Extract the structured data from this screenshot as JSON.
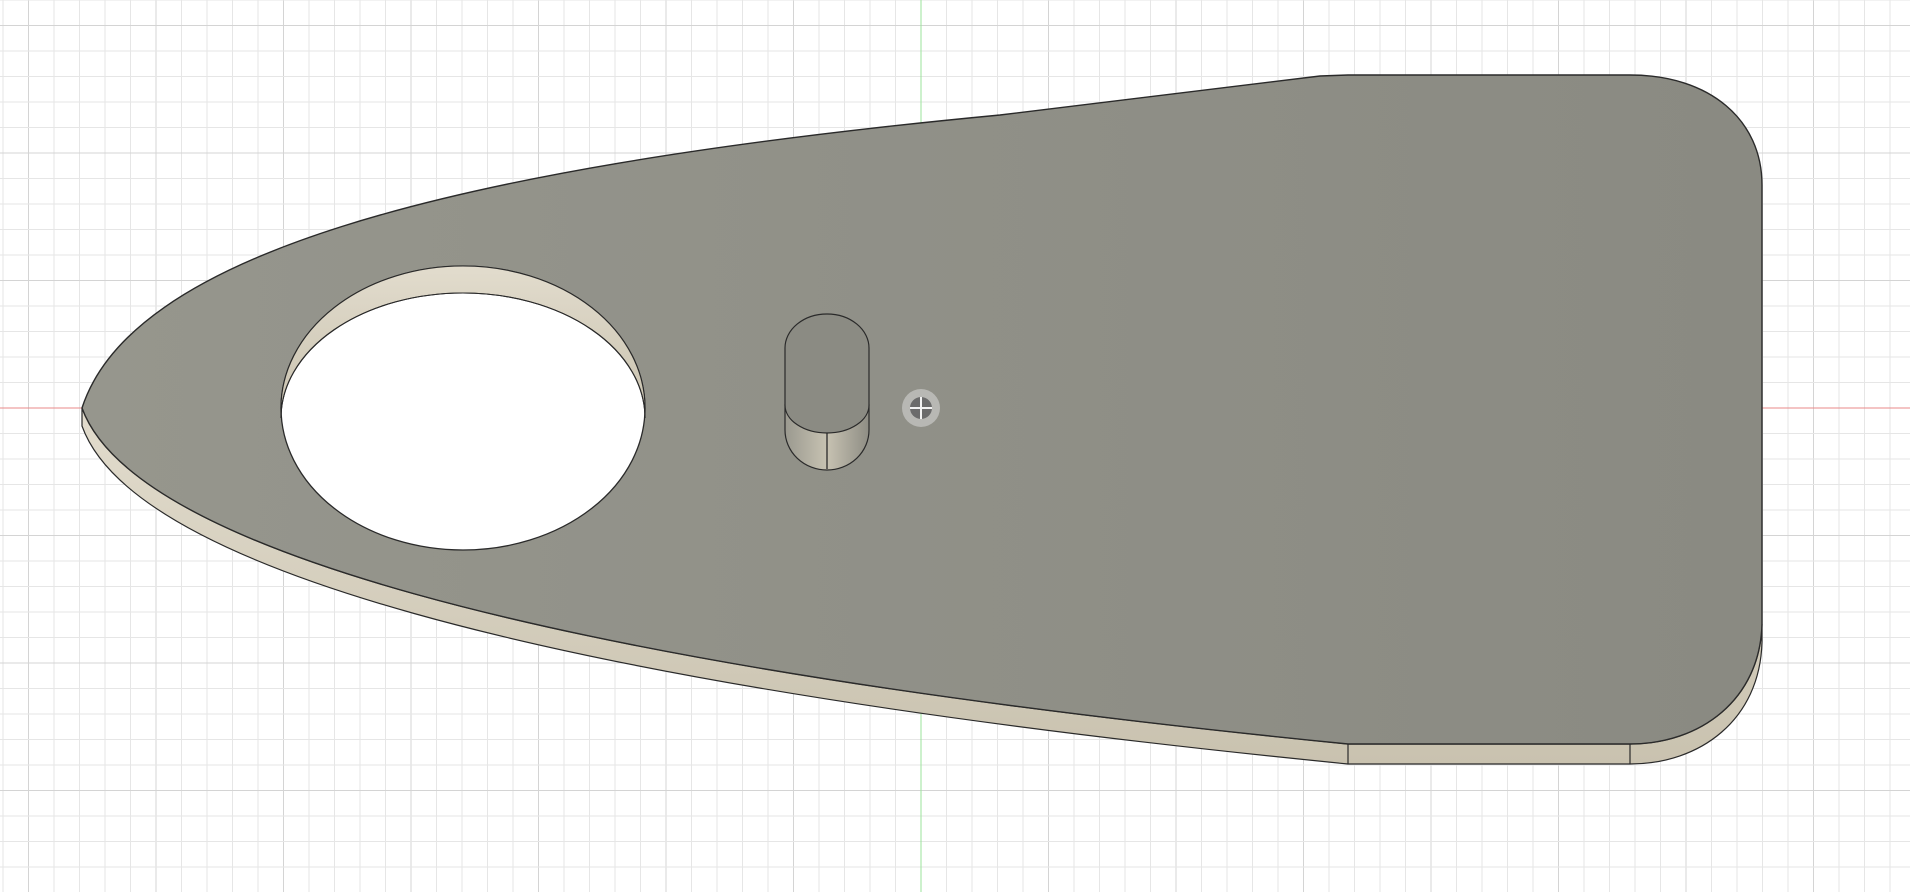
{
  "canvas": {
    "background": "#ffffff",
    "grid_minor_color": "#e6e6e6",
    "grid_major_color": "#d4d4d4",
    "x_axis_color": "#e88a8a",
    "y_axis_color": "#9be39b"
  },
  "part": {
    "top_face_color": "#8c8c84",
    "side_face_color": "#d8d2c2",
    "edge_color": "#2a2a2a",
    "hole_shape": "circle",
    "boss_shape": "slot"
  },
  "origin": {
    "icon": "origin-icon",
    "color": "#6b6b6b"
  }
}
